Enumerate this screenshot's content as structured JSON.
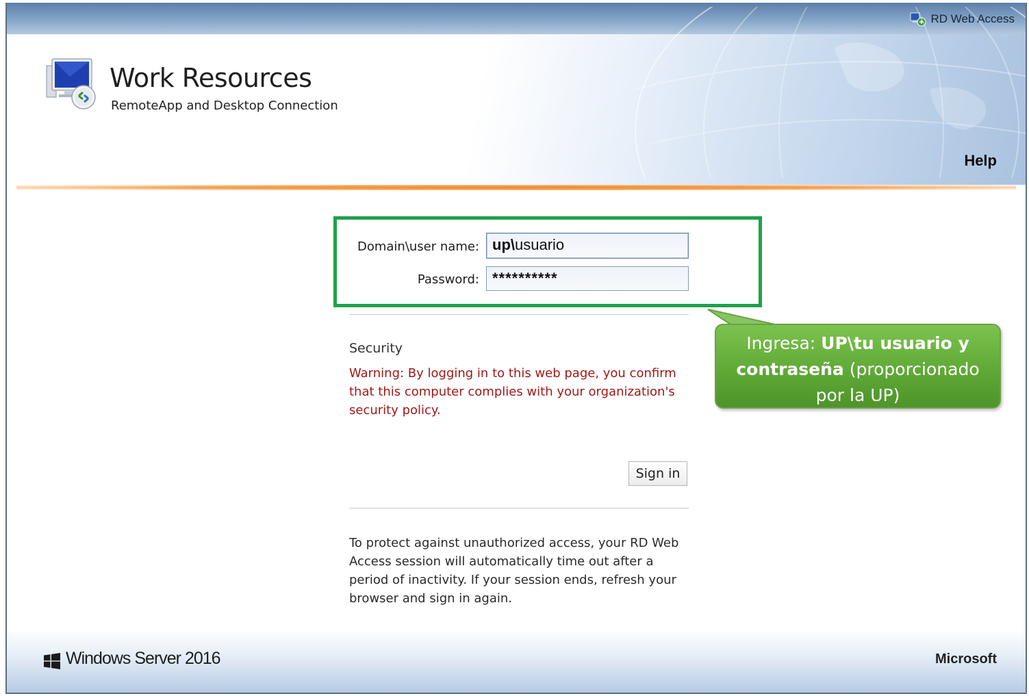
{
  "topbar": {
    "link_label": "RD Web Access",
    "icon": "rd-web-access-icon"
  },
  "header": {
    "title": "Work Resources",
    "subtitle": "RemoteApp and Desktop Connection",
    "help_label": "Help",
    "app_icon": "remoteapp-monitor-icon"
  },
  "login_form": {
    "username_label": "Domain\\user name:",
    "username_prefix": "up\\",
    "username_rest": "usuario",
    "password_label": "Password:",
    "password_mask": "**********"
  },
  "security": {
    "title": "Security",
    "warning": "Warning: By logging in to this web page, you confirm that this computer complies with your organization's security policy."
  },
  "signin_button": {
    "label": "Sign in"
  },
  "info_text": "To protect against unauthorized access, your RD Web Access session will automatically time out after a period of inactivity. If your session ends, refresh your browser and sign in again.",
  "callout": {
    "part1": "Ingresa: ",
    "part2_bold": "UP\\tu usuario y contraseña",
    "part3": " (proporcionado por la UP)"
  },
  "footer": {
    "os_label": "Windows Server 2016",
    "vendor_label": "Microsoft",
    "logo_icon": "windows-logo-icon"
  },
  "colors": {
    "highlight_border": "#1ea24a",
    "callout_green": "#5ea735",
    "warning_red": "#a01818",
    "orange_rule": "#f08a2a"
  }
}
